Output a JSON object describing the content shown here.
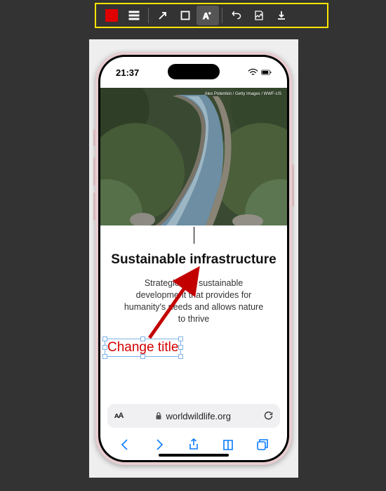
{
  "toolbar": {
    "color": "#e10000"
  },
  "statusbar": {
    "time": "21:37"
  },
  "hero": {
    "credit": "Alex Potemkin / Getty Images / WWF-US"
  },
  "article": {
    "title": "Sustainable infrastructure",
    "subtitle": "Strategic and sustainable development that provides for humanity's needs and allows nature to thrive"
  },
  "annotation": {
    "text": "Change title"
  },
  "browser": {
    "reader_label": "ᴀA",
    "domain": "worldwildlife.org"
  }
}
